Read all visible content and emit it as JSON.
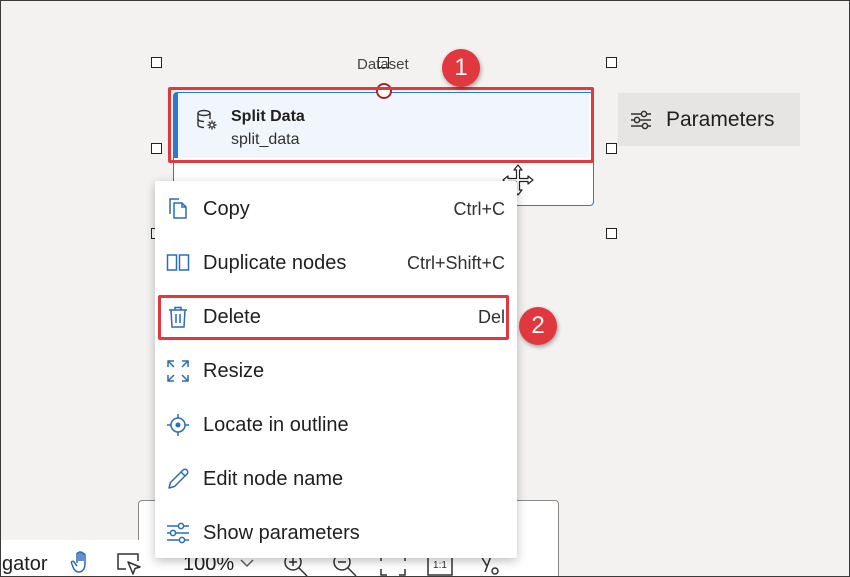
{
  "canvas": {
    "dataset_label": "Dataset",
    "node": {
      "title": "Split Data",
      "subtitle": "split_data"
    },
    "parameters_button": {
      "label": "Parameters"
    }
  },
  "annotations": {
    "badge_1": "1",
    "badge_2": "2",
    "highlight_color": "#e0383e"
  },
  "context_menu": {
    "items": [
      {
        "label": "Copy",
        "shortcut": "Ctrl+C",
        "icon": "copy-icon"
      },
      {
        "label": "Duplicate nodes",
        "shortcut": "Ctrl+Shift+C",
        "icon": "duplicate-icon"
      },
      {
        "label": "Delete",
        "shortcut": "Del",
        "icon": "trash-icon"
      },
      {
        "label": "Resize",
        "shortcut": "",
        "icon": "resize-icon"
      },
      {
        "label": "Locate in outline",
        "shortcut": "",
        "icon": "locate-icon"
      },
      {
        "label": "Edit node name",
        "shortcut": "",
        "icon": "pencil-icon"
      },
      {
        "label": "Show parameters",
        "shortcut": "",
        "icon": "sliders-icon"
      }
    ]
  },
  "bottom_toolbar": {
    "navigator_label": "gator",
    "zoom_level": "100%"
  },
  "colors": {
    "accent": "#2b79d0",
    "icon_blue": "#2b6cb5",
    "badge_red": "#e0383e"
  }
}
